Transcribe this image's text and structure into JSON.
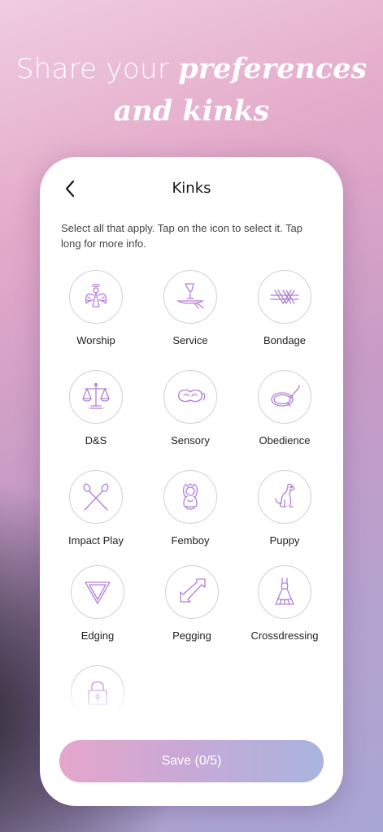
{
  "headline": {
    "line1": "Share your ",
    "emphasis1": "preferences",
    "emphasis2": "and kinks"
  },
  "screen": {
    "title": "Kinks",
    "instructions": "Select all that apply. Tap on the icon to select it. Tap long for more info."
  },
  "kinks": [
    {
      "label": "Worship",
      "icon": "angel-icon"
    },
    {
      "label": "Service",
      "icon": "serving-tray-icon"
    },
    {
      "label": "Bondage",
      "icon": "rope-icon"
    },
    {
      "label": "D&S",
      "icon": "scales-icon"
    },
    {
      "label": "Sensory",
      "icon": "blindfold-icon"
    },
    {
      "label": "Obedience",
      "icon": "leash-icon"
    },
    {
      "label": "Impact Play",
      "icon": "paddles-icon"
    },
    {
      "label": "Femboy",
      "icon": "femboy-icon"
    },
    {
      "label": "Puppy",
      "icon": "dog-icon"
    },
    {
      "label": "Edging",
      "icon": "triangle-icon"
    },
    {
      "label": "Pegging",
      "icon": "double-arrow-icon"
    },
    {
      "label": "Crossdressing",
      "icon": "dress-icon"
    },
    {
      "label": "",
      "icon": "lock-icon"
    }
  ],
  "save": {
    "label": "Save (0/5)"
  },
  "colors": {
    "icon_stroke": "#b37fd6",
    "circle_border": "#d3d0d6",
    "button_gradient_start": "#e5a6cb",
    "button_gradient_end": "#a9b4de"
  }
}
